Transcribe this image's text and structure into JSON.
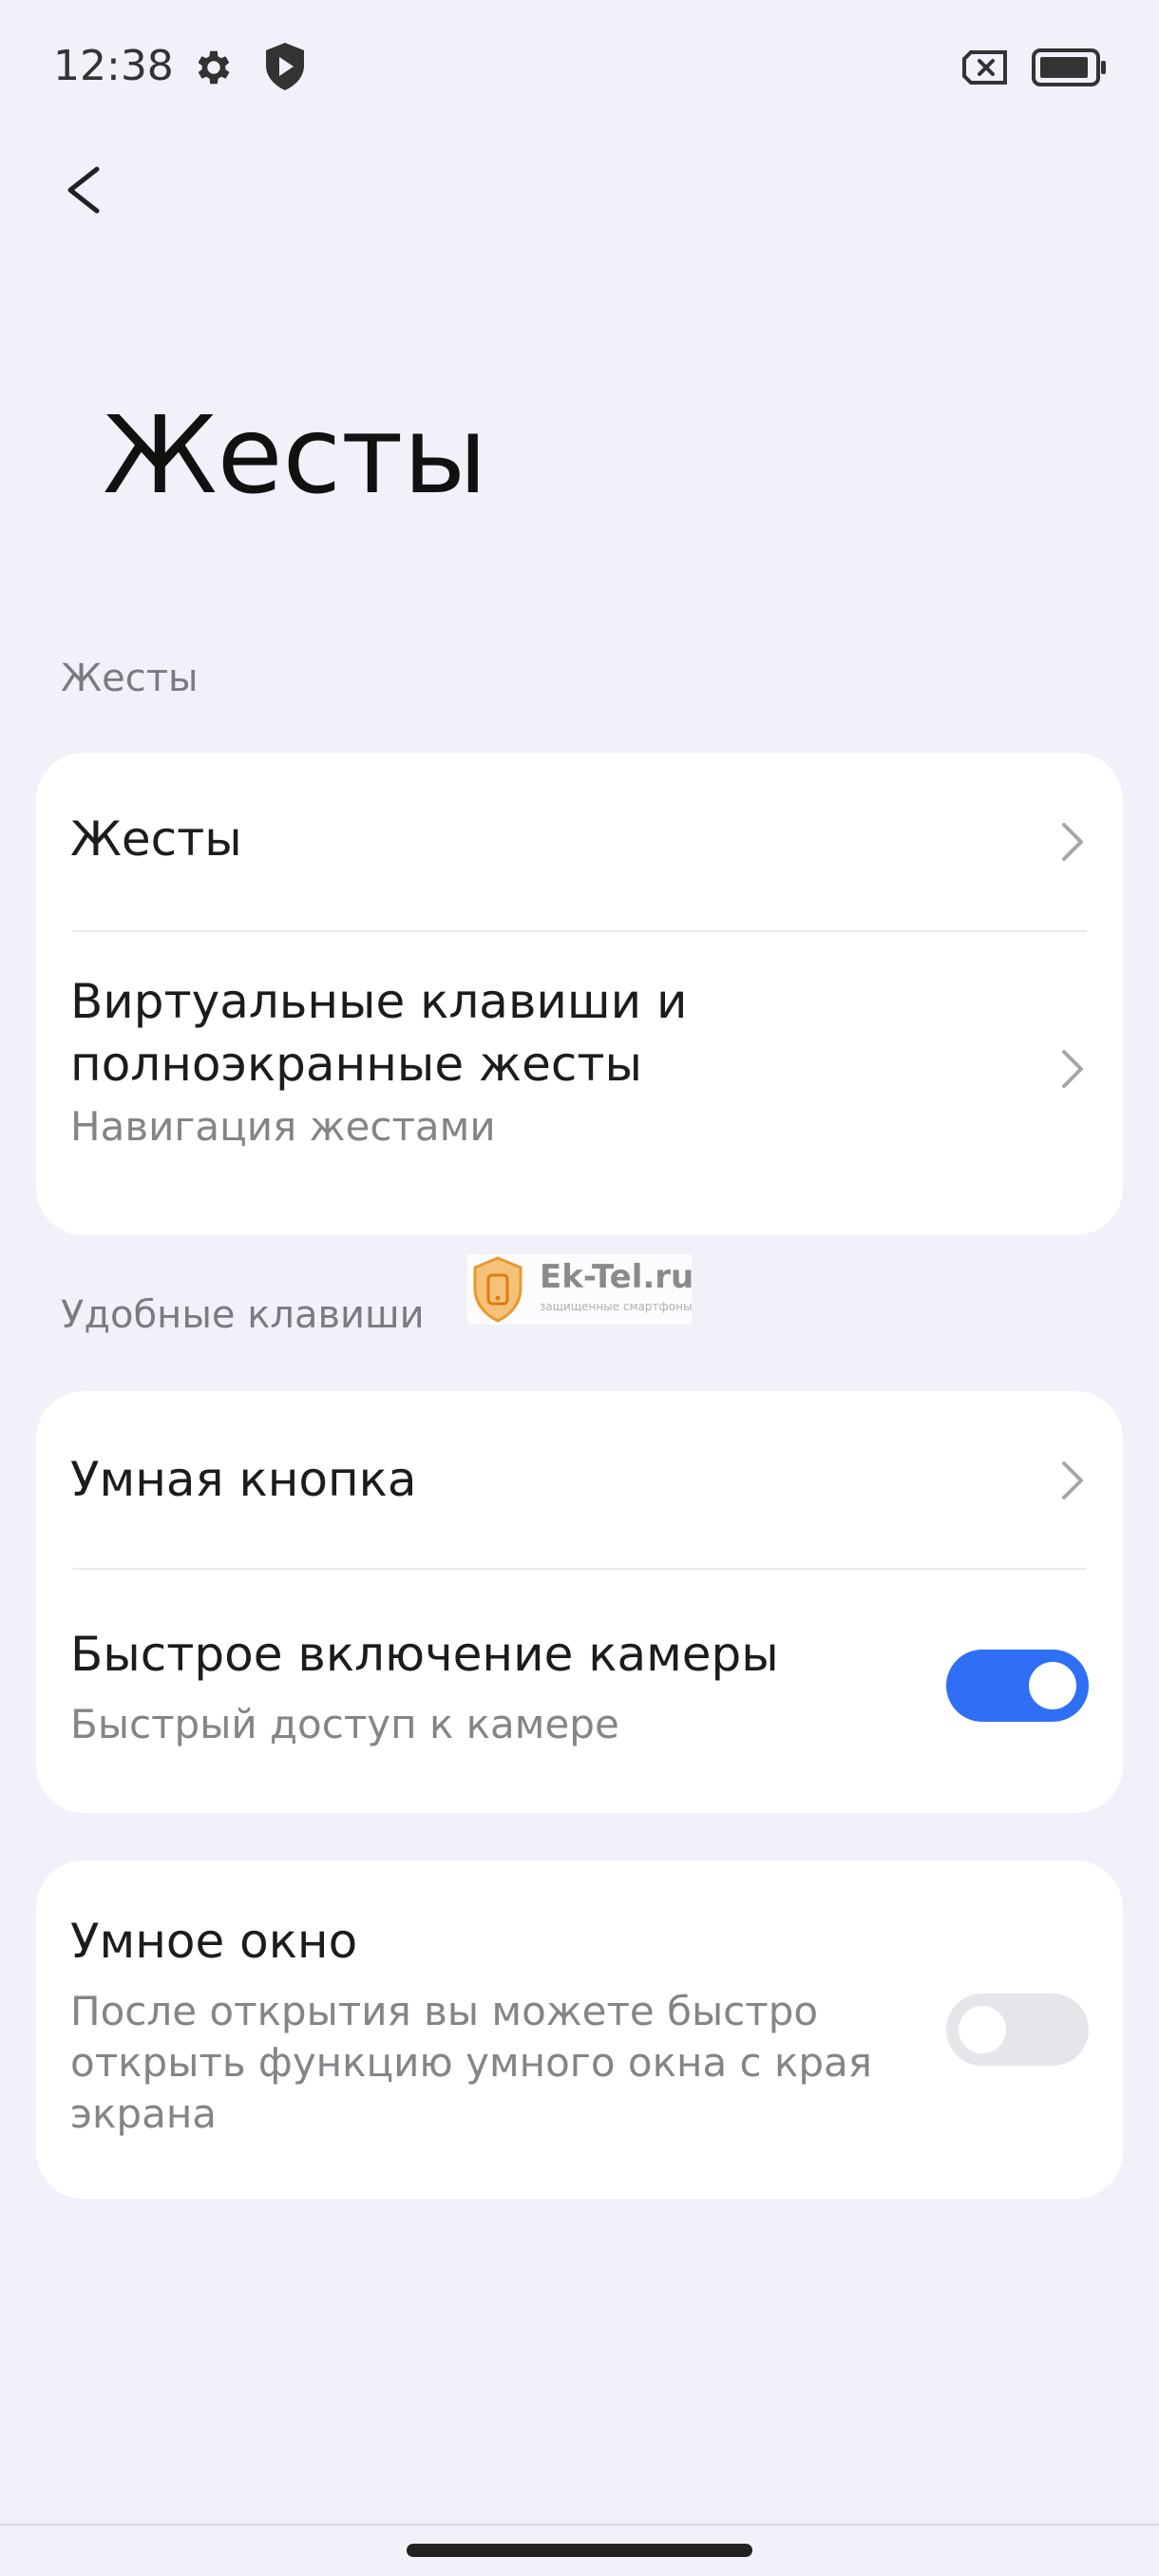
{
  "status_bar": {
    "time": "12:38",
    "icons": [
      "gear-icon",
      "shield-play-icon",
      "sim-off-icon",
      "battery-icon"
    ]
  },
  "header": {
    "back_icon": "chevron-left-icon",
    "title": "Жесты"
  },
  "sections": [
    {
      "label": "Жесты",
      "items": [
        {
          "title": "Жесты",
          "control": "chevron"
        },
        {
          "title_line1": "Виртуальные клавиши и",
          "title_line2": "полноэкранные жесты",
          "subtitle": "Навигация жестами",
          "control": "chevron"
        }
      ]
    },
    {
      "label": "Удобные клавиши",
      "items": [
        {
          "title": "Умная кнопка",
          "control": "chevron"
        },
        {
          "title": "Быстрое включение камеры",
          "subtitle": "Быстрый доступ к камере",
          "control": "toggle",
          "enabled": true
        }
      ]
    },
    {
      "label": "",
      "items": [
        {
          "title": "Умное окно",
          "subtitle_line1": "После открытия вы можете быстро",
          "subtitle_line2": "открыть функцию умного окна с края",
          "subtitle_line3": "экрана",
          "control": "toggle",
          "enabled": false
        }
      ]
    }
  ],
  "watermark": {
    "text": "Ek-Tel.ru",
    "subtext": "защищенные смартфоны"
  },
  "colors": {
    "background": "#f1f1f9",
    "card": "#ffffff",
    "accent": "#2f6ff5",
    "toggle_off": "#e6e6ea"
  }
}
